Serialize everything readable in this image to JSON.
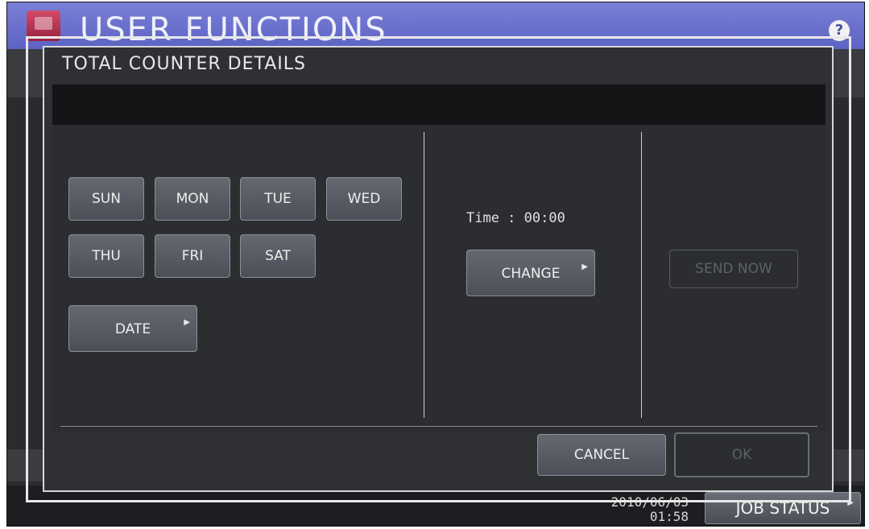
{
  "header": {
    "title": "USER FUNCTIONS",
    "help_label": "?"
  },
  "dialog": {
    "title": "TOTAL COUNTER DETAILS",
    "days": [
      "SUN",
      "MON",
      "TUE",
      "WED",
      "THU",
      "FRI",
      "SAT"
    ],
    "date_label": "DATE",
    "time_text": "Time : 00:00",
    "change_label": "CHANGE",
    "send_now_label": "SEND NOW",
    "cancel_label": "CANCEL",
    "ok_label": "OK"
  },
  "footer": {
    "date_text": "2010/06/03",
    "time_text": "01:58",
    "job_status_label": "JOB STATUS"
  },
  "colors": {
    "title_bar": "#6a6fd0",
    "dialog_bg": "#2e3034",
    "button_bg": "#5a5d65"
  },
  "icons": [
    "app-icon",
    "help-icon",
    "arrow-right-icon"
  ]
}
